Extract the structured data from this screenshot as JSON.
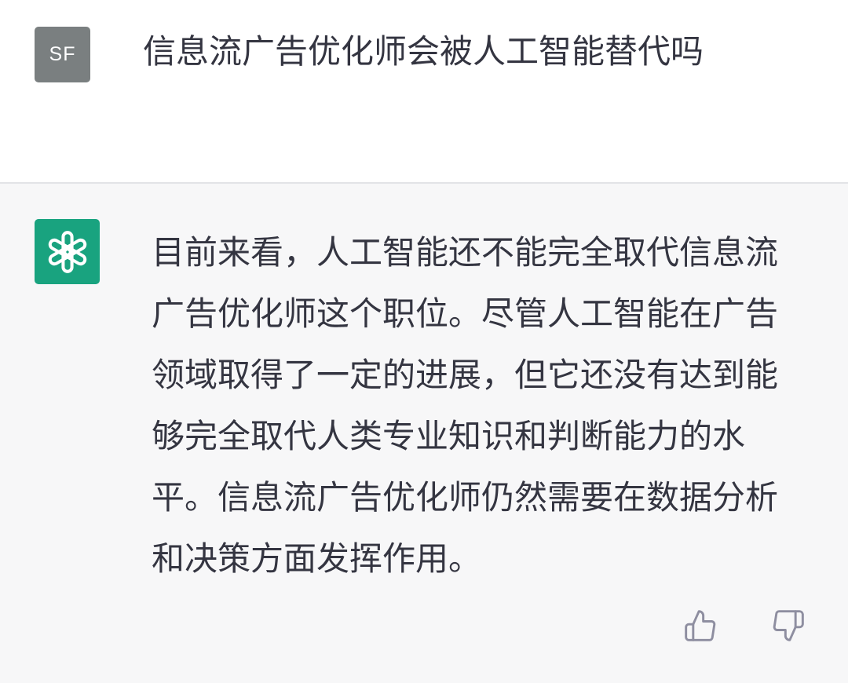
{
  "user": {
    "avatar_text": "SF",
    "message": "信息流广告优化师会被人工智能替代吗"
  },
  "assistant": {
    "avatar_icon": "openai-logo-icon",
    "lines": [
      "目前来看，人工智能还不能完全取代信息流",
      "广告优化师这个职位。尽管人工智能在广告",
      "领域取得了一定的进展，但它还没有达到能",
      "够完全取代人类专业知识和判断能力的水",
      "平。信息流广告优化师仍然需要在数据分析",
      "和决策方面发挥作用。"
    ]
  },
  "feedback": {
    "thumbs_up_icon": "thumbs-up-icon",
    "thumbs_down_icon": "thumbs-down-icon"
  },
  "colors": {
    "user_avatar_bg": "#7a7f80",
    "assistant_avatar_bg": "#19a37f",
    "assistant_block_bg": "#f7f7f8",
    "text": "#343541",
    "icon": "#8e8ea0"
  }
}
